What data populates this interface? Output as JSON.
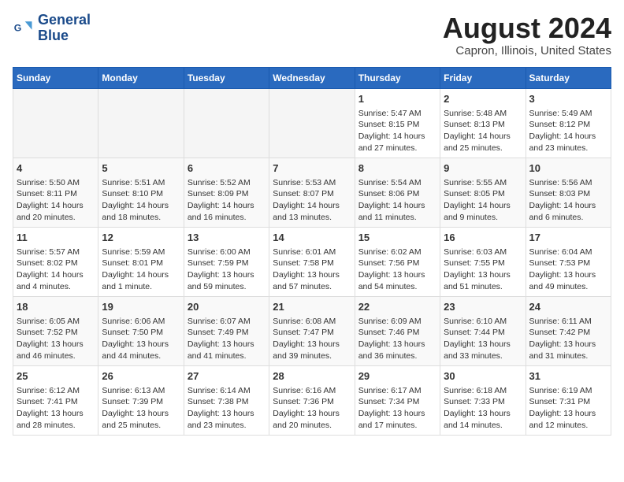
{
  "logo": {
    "line1": "General",
    "line2": "Blue"
  },
  "title": "August 2024",
  "subtitle": "Capron, Illinois, United States",
  "days_of_week": [
    "Sunday",
    "Monday",
    "Tuesday",
    "Wednesday",
    "Thursday",
    "Friday",
    "Saturday"
  ],
  "weeks": [
    [
      {
        "day": "",
        "info": ""
      },
      {
        "day": "",
        "info": ""
      },
      {
        "day": "",
        "info": ""
      },
      {
        "day": "",
        "info": ""
      },
      {
        "day": "1",
        "info": "Sunrise: 5:47 AM\nSunset: 8:15 PM\nDaylight: 14 hours\nand 27 minutes."
      },
      {
        "day": "2",
        "info": "Sunrise: 5:48 AM\nSunset: 8:13 PM\nDaylight: 14 hours\nand 25 minutes."
      },
      {
        "day": "3",
        "info": "Sunrise: 5:49 AM\nSunset: 8:12 PM\nDaylight: 14 hours\nand 23 minutes."
      }
    ],
    [
      {
        "day": "4",
        "info": "Sunrise: 5:50 AM\nSunset: 8:11 PM\nDaylight: 14 hours\nand 20 minutes."
      },
      {
        "day": "5",
        "info": "Sunrise: 5:51 AM\nSunset: 8:10 PM\nDaylight: 14 hours\nand 18 minutes."
      },
      {
        "day": "6",
        "info": "Sunrise: 5:52 AM\nSunset: 8:09 PM\nDaylight: 14 hours\nand 16 minutes."
      },
      {
        "day": "7",
        "info": "Sunrise: 5:53 AM\nSunset: 8:07 PM\nDaylight: 14 hours\nand 13 minutes."
      },
      {
        "day": "8",
        "info": "Sunrise: 5:54 AM\nSunset: 8:06 PM\nDaylight: 14 hours\nand 11 minutes."
      },
      {
        "day": "9",
        "info": "Sunrise: 5:55 AM\nSunset: 8:05 PM\nDaylight: 14 hours\nand 9 minutes."
      },
      {
        "day": "10",
        "info": "Sunrise: 5:56 AM\nSunset: 8:03 PM\nDaylight: 14 hours\nand 6 minutes."
      }
    ],
    [
      {
        "day": "11",
        "info": "Sunrise: 5:57 AM\nSunset: 8:02 PM\nDaylight: 14 hours\nand 4 minutes."
      },
      {
        "day": "12",
        "info": "Sunrise: 5:59 AM\nSunset: 8:01 PM\nDaylight: 14 hours\nand 1 minute."
      },
      {
        "day": "13",
        "info": "Sunrise: 6:00 AM\nSunset: 7:59 PM\nDaylight: 13 hours\nand 59 minutes."
      },
      {
        "day": "14",
        "info": "Sunrise: 6:01 AM\nSunset: 7:58 PM\nDaylight: 13 hours\nand 57 minutes."
      },
      {
        "day": "15",
        "info": "Sunrise: 6:02 AM\nSunset: 7:56 PM\nDaylight: 13 hours\nand 54 minutes."
      },
      {
        "day": "16",
        "info": "Sunrise: 6:03 AM\nSunset: 7:55 PM\nDaylight: 13 hours\nand 51 minutes."
      },
      {
        "day": "17",
        "info": "Sunrise: 6:04 AM\nSunset: 7:53 PM\nDaylight: 13 hours\nand 49 minutes."
      }
    ],
    [
      {
        "day": "18",
        "info": "Sunrise: 6:05 AM\nSunset: 7:52 PM\nDaylight: 13 hours\nand 46 minutes."
      },
      {
        "day": "19",
        "info": "Sunrise: 6:06 AM\nSunset: 7:50 PM\nDaylight: 13 hours\nand 44 minutes."
      },
      {
        "day": "20",
        "info": "Sunrise: 6:07 AM\nSunset: 7:49 PM\nDaylight: 13 hours\nand 41 minutes."
      },
      {
        "day": "21",
        "info": "Sunrise: 6:08 AM\nSunset: 7:47 PM\nDaylight: 13 hours\nand 39 minutes."
      },
      {
        "day": "22",
        "info": "Sunrise: 6:09 AM\nSunset: 7:46 PM\nDaylight: 13 hours\nand 36 minutes."
      },
      {
        "day": "23",
        "info": "Sunrise: 6:10 AM\nSunset: 7:44 PM\nDaylight: 13 hours\nand 33 minutes."
      },
      {
        "day": "24",
        "info": "Sunrise: 6:11 AM\nSunset: 7:42 PM\nDaylight: 13 hours\nand 31 minutes."
      }
    ],
    [
      {
        "day": "25",
        "info": "Sunrise: 6:12 AM\nSunset: 7:41 PM\nDaylight: 13 hours\nand 28 minutes."
      },
      {
        "day": "26",
        "info": "Sunrise: 6:13 AM\nSunset: 7:39 PM\nDaylight: 13 hours\nand 25 minutes."
      },
      {
        "day": "27",
        "info": "Sunrise: 6:14 AM\nSunset: 7:38 PM\nDaylight: 13 hours\nand 23 minutes."
      },
      {
        "day": "28",
        "info": "Sunrise: 6:16 AM\nSunset: 7:36 PM\nDaylight: 13 hours\nand 20 minutes."
      },
      {
        "day": "29",
        "info": "Sunrise: 6:17 AM\nSunset: 7:34 PM\nDaylight: 13 hours\nand 17 minutes."
      },
      {
        "day": "30",
        "info": "Sunrise: 6:18 AM\nSunset: 7:33 PM\nDaylight: 13 hours\nand 14 minutes."
      },
      {
        "day": "31",
        "info": "Sunrise: 6:19 AM\nSunset: 7:31 PM\nDaylight: 13 hours\nand 12 minutes."
      }
    ]
  ]
}
